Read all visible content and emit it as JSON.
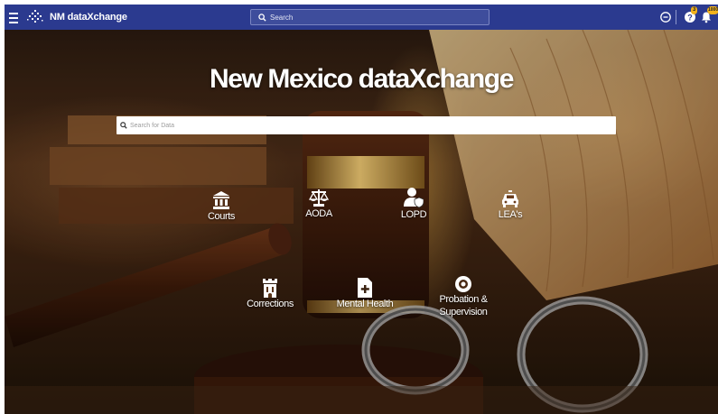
{
  "header": {
    "app_title": "NM dataXchange",
    "search_placeholder": "Search",
    "notifications_badge": "3",
    "help_badge": "3",
    "avatar_badge": "1000"
  },
  "hero": {
    "title": "New Mexico dataXchange",
    "search_placeholder": "Search for Data"
  },
  "categories": [
    {
      "label": "Courts",
      "icon": "courthouse-icon"
    },
    {
      "label": "AODA",
      "icon": "scales-icon"
    },
    {
      "label": "LOPD",
      "icon": "user-shield-icon"
    },
    {
      "label": "LEA's",
      "icon": "police-car-icon"
    },
    {
      "label": "Corrections",
      "icon": "prison-tower-icon"
    },
    {
      "label": "Mental Health",
      "icon": "medical-file-icon"
    },
    {
      "label": "Probation &",
      "label2": "Supervision",
      "icon": "eye-icon"
    }
  ],
  "colors": {
    "topbar": "#2b3a8f",
    "badge": "#f2b21c"
  }
}
